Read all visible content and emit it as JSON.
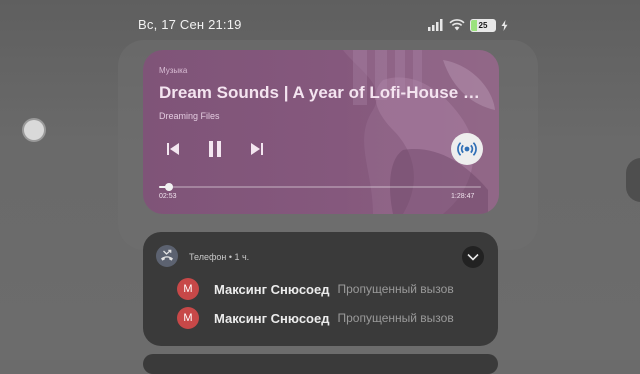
{
  "status_bar": {
    "datetime": "Вс, 17 Сен 21:19",
    "battery_level": "25",
    "battery_fraction": 0.25,
    "icons": [
      "signal-icon",
      "wifi-icon",
      "battery-icon",
      "charging-bolt-icon"
    ]
  },
  "media": {
    "source_app": "Музыка",
    "title": "Dream Sounds | A year of Lofi-House Mi...",
    "artist": "Dreaming Files",
    "elapsed": "02:53",
    "duration": "1:28:47",
    "progress_fraction": 0.0325,
    "controls": [
      "previous-track-icon",
      "pause-icon",
      "next-track-icon"
    ],
    "cast_icon": "cast-icon",
    "card_color": "#85587d"
  },
  "notification": {
    "header": "Телефон • 1 ч.",
    "app_icon": "missed-call-icon",
    "expand_icon": "chevron-down-icon",
    "items": [
      {
        "avatar_letter": "М",
        "name": "Максинг Снюсоед",
        "status": "Пропущенный вызов"
      },
      {
        "avatar_letter": "М",
        "name": "Максинг Снюсоед",
        "status": "Пропущенный вызов"
      }
    ],
    "avatar_color": "#c74848"
  }
}
